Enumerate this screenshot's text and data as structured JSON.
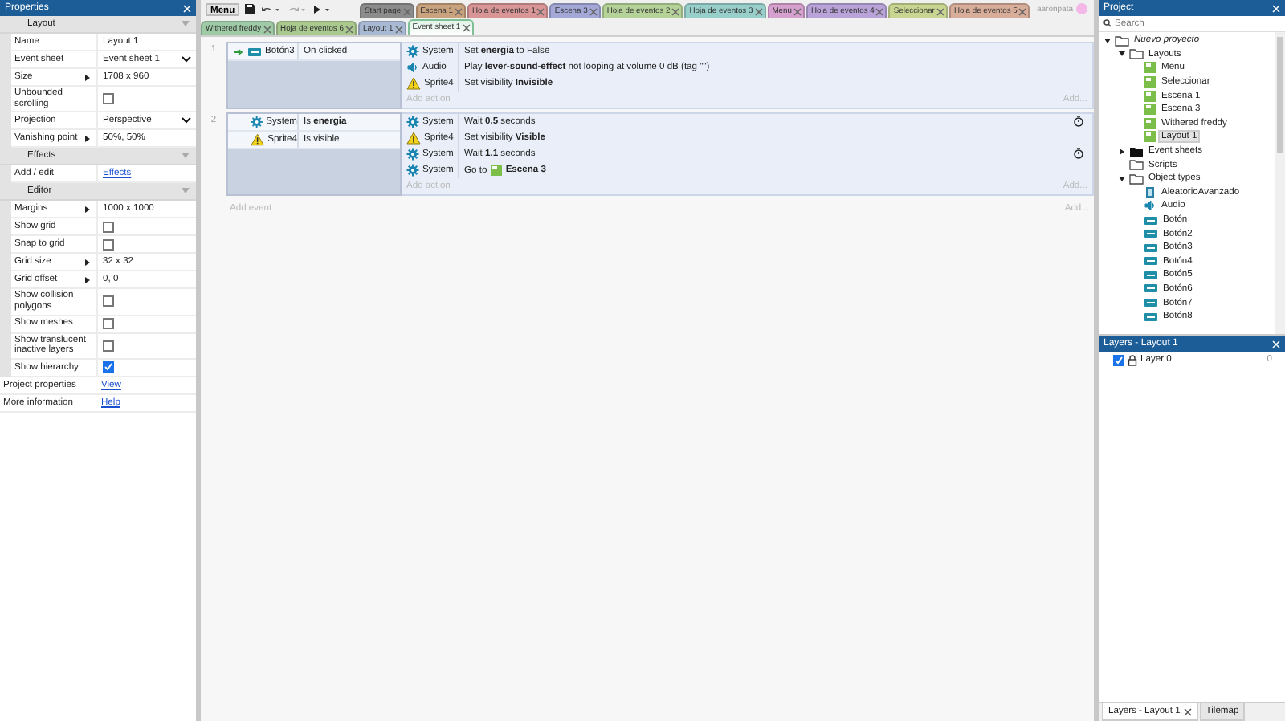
{
  "properties_panel": {
    "title": "Properties",
    "sections": [
      {
        "title": "Layout",
        "rows": [
          {
            "label": "Name",
            "kind": "text",
            "value": "Layout 1",
            "expandable": false
          },
          {
            "label": "Event sheet",
            "kind": "dropdown",
            "value": "Event sheet 1",
            "expandable": false
          },
          {
            "label": "Size",
            "kind": "text",
            "value": "1708 x 960",
            "expandable": true
          },
          {
            "label": "Unbounded scrolling",
            "kind": "checkbox",
            "checked": false,
            "expandable": false
          },
          {
            "label": "Projection",
            "kind": "dropdown",
            "value": "Perspective",
            "expandable": false
          },
          {
            "label": "Vanishing point",
            "kind": "text",
            "value": "50%, 50%",
            "expandable": true
          }
        ]
      },
      {
        "title": "Effects",
        "rows": [
          {
            "label": "Add / edit",
            "kind": "link",
            "value": "Effects",
            "expandable": false
          }
        ]
      },
      {
        "title": "Editor",
        "rows": [
          {
            "label": "Margins",
            "kind": "text",
            "value": "1000 x 1000",
            "expandable": true
          },
          {
            "label": "Show grid",
            "kind": "checkbox",
            "checked": false,
            "expandable": false
          },
          {
            "label": "Snap to grid",
            "kind": "checkbox",
            "checked": false,
            "expandable": false
          },
          {
            "label": "Grid size",
            "kind": "text",
            "value": "32 x 32",
            "expandable": true
          },
          {
            "label": "Grid offset",
            "kind": "text",
            "value": "0, 0",
            "expandable": true
          },
          {
            "label": "Show collision polygons",
            "kind": "checkbox",
            "checked": false,
            "expandable": false
          },
          {
            "label": "Show meshes",
            "kind": "checkbox",
            "checked": false,
            "expandable": false
          },
          {
            "label": "Show translucent inactive layers",
            "kind": "checkbox",
            "checked": false,
            "expandable": false
          },
          {
            "label": "Show hierarchy",
            "kind": "checkbox",
            "checked": true,
            "expandable": false
          }
        ]
      }
    ],
    "footer": [
      {
        "label": "Project properties",
        "link": "View"
      },
      {
        "label": "More information",
        "link": "Help"
      }
    ]
  },
  "toolbar": {
    "menu": "Menu"
  },
  "tabs_row_1": [
    {
      "label": "Start page",
      "color": "#8c8c8c",
      "selected": false
    },
    {
      "label": "Escena 1",
      "color": "#c9a27e",
      "selected": false
    },
    {
      "label": "Hoja de eventos 1",
      "color": "#d99696",
      "selected": false
    },
    {
      "label": "Escena 3",
      "color": "#a3a8d6",
      "selected": false
    },
    {
      "label": "Hoja de eventos 2",
      "color": "#b5d398",
      "selected": false
    },
    {
      "label": "Hoja de eventos 3",
      "color": "#98cfcb",
      "selected": false
    },
    {
      "label": "Menu",
      "color": "#d6a0cf",
      "selected": false
    },
    {
      "label": "Hoja de eventos 4",
      "color": "#b9a3d9",
      "selected": false
    },
    {
      "label": "Seleccionar",
      "color": "#c9d692",
      "selected": false
    },
    {
      "label": "Hoja de eventos 5",
      "color": "#d8ad9a",
      "selected": false
    }
  ],
  "tabs_row_2": [
    {
      "label": "Withered freddy",
      "color": "#9fcaa6",
      "selected": false
    },
    {
      "label": "Hoja de eventos 6",
      "color": "#a9c98f",
      "selected": false
    },
    {
      "label": "Layout 1",
      "color": "#a7b9d3",
      "selected": false
    },
    {
      "label": "Event sheet 1",
      "color": "#dff3e6",
      "selected": true
    }
  ],
  "user": {
    "name": "aaronpata"
  },
  "event_sheet": {
    "events": [
      {
        "number": "1",
        "trigger": true,
        "conditions": [
          {
            "object": "Botón3",
            "kind": "button",
            "text": "On clicked"
          }
        ],
        "actions": [
          {
            "object": "System",
            "kind": "system",
            "text": "Set **energia** to False",
            "timer": false
          },
          {
            "object": "Audio",
            "kind": "audio",
            "text": "Play **lever-sound-effect** not looping at volume 0 dB (tag \"\")",
            "timer": false
          },
          {
            "object": "Sprite4",
            "kind": "sprite",
            "text": "Set visibility **Invisible**",
            "timer": false
          }
        ],
        "add_action": "Add action",
        "add": "Add..."
      },
      {
        "number": "2",
        "trigger": false,
        "conditions": [
          {
            "object": "System",
            "kind": "system",
            "text": "Is **energia**"
          },
          {
            "object": "Sprite4",
            "kind": "sprite",
            "text": "Is visible"
          }
        ],
        "actions": [
          {
            "object": "System",
            "kind": "system",
            "text": "Wait **0.5** seconds",
            "timer": true
          },
          {
            "object": "Sprite4",
            "kind": "sprite",
            "text": "Set visibility **Visible**",
            "timer": false
          },
          {
            "object": "System",
            "kind": "system",
            "text": "Wait **1.1** seconds",
            "timer": true
          },
          {
            "object": "System",
            "kind": "system",
            "text": "Go to",
            "target": "Escena 3",
            "timer": false
          }
        ],
        "add_action": "Add action",
        "add": "Add..."
      }
    ],
    "add_event": "Add event",
    "add": "Add..."
  },
  "project_panel": {
    "title": "Project",
    "search_placeholder": "Search",
    "tree": [
      {
        "label": "Nuevo proyecto",
        "kind": "folder",
        "expanded": true,
        "selected": false,
        "children": [
          {
            "label": "Layouts",
            "kind": "folder",
            "expanded": true,
            "selected": false,
            "children": [
              {
                "label": "Menu",
                "kind": "layout",
                "selected": false
              },
              {
                "label": "Seleccionar",
                "kind": "layout",
                "selected": false
              },
              {
                "label": "Escena 1",
                "kind": "layout",
                "selected": false
              },
              {
                "label": "Escena 3",
                "kind": "layout",
                "selected": false
              },
              {
                "label": "Withered freddy",
                "kind": "layout",
                "selected": false
              },
              {
                "label": "Layout 1",
                "kind": "layout",
                "selected": true
              }
            ]
          },
          {
            "label": "Event sheets",
            "kind": "eventsheets",
            "expanded": false,
            "selected": false
          },
          {
            "label": "Scripts",
            "kind": "folder",
            "selected": false
          },
          {
            "label": "Object types",
            "kind": "folder",
            "expanded": true,
            "selected": false,
            "children": [
              {
                "label": "AleatorioAvanzado",
                "kind": "plugin",
                "selected": false
              },
              {
                "label": "Audio",
                "kind": "audio",
                "selected": false
              },
              {
                "label": "Botón",
                "kind": "button",
                "selected": false
              },
              {
                "label": "Botón2",
                "kind": "button",
                "selected": false
              },
              {
                "label": "Botón3",
                "kind": "button",
                "selected": false
              },
              {
                "label": "Botón4",
                "kind": "button",
                "selected": false
              },
              {
                "label": "Botón5",
                "kind": "button",
                "selected": false
              },
              {
                "label": "Botón6",
                "kind": "button",
                "selected": false
              },
              {
                "label": "Botón7",
                "kind": "button",
                "selected": false
              },
              {
                "label": "Botón8",
                "kind": "button",
                "selected": false
              }
            ]
          }
        ]
      }
    ]
  },
  "layers_panel": {
    "title": "Layers - Layout 1",
    "layers": [
      {
        "name": "Layer 0",
        "visible": true,
        "count": "0"
      }
    ]
  },
  "bottom_tabs": [
    {
      "label": "Layers - Layout 1",
      "selected": true
    },
    {
      "label": "Tilemap",
      "selected": false
    }
  ]
}
